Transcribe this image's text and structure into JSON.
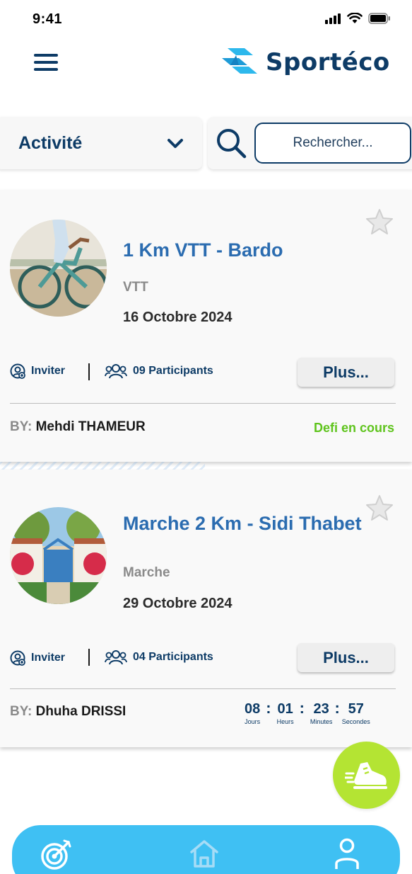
{
  "status_bar": {
    "time": "9:41"
  },
  "header": {
    "logo_text": "Sportéco"
  },
  "filter": {
    "activity_label": "Activité",
    "search_placeholder": "Rechercher..."
  },
  "colors": {
    "primary": "#0d3b66",
    "title_blue": "#2b6cb0",
    "status_green": "#5fc41d",
    "fab_green": "#b4e433",
    "nav_blue": "#3fc0f3"
  },
  "cards": [
    {
      "title": "1 Km VTT - Bardo",
      "type": "VTT",
      "date": "16 Octobre 2024",
      "invite_label": "Inviter",
      "participants_label": "09 Participants",
      "more_label": "Plus...",
      "by_label": "BY:",
      "author": "Mehdi THAMEUR",
      "status": "Defi en cours"
    },
    {
      "title": "Marche 2 Km - Sidi Thabet",
      "type": "Marche",
      "date": "29 Octobre 2024",
      "invite_label": "Inviter",
      "participants_label": "04 Participants",
      "more_label": "Plus...",
      "by_label": "BY:",
      "author": "Dhuha DRISSI",
      "countdown": {
        "days": "08",
        "days_label": "Jours",
        "hours": "01",
        "hours_label": "Heurs",
        "minutes": "23",
        "minutes_label": "Minutes",
        "seconds": "57",
        "seconds_label": "Secondes"
      }
    }
  ],
  "icons": {
    "menu": "hamburger-icon",
    "chevron": "chevron-down-icon",
    "search": "search-icon",
    "star": "star-icon",
    "invite": "add-user-icon",
    "participants": "group-icon",
    "fab": "sneaker-icon",
    "nav": [
      "target-icon",
      "home-icon",
      "user-icon"
    ]
  }
}
